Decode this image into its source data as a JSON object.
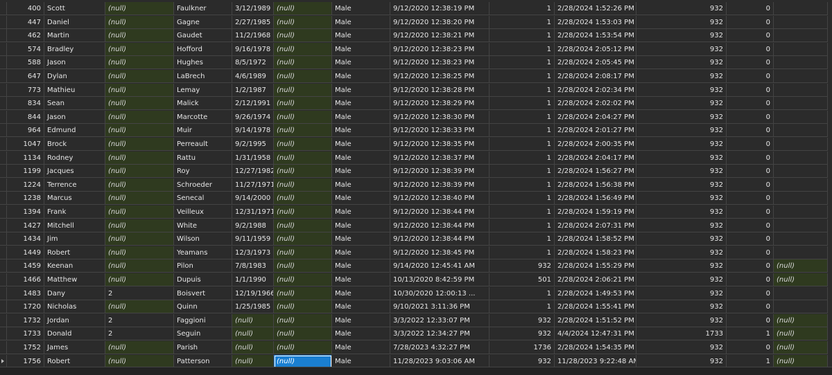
{
  "rows": [
    [
      "400",
      "Scott",
      "(null)",
      "Faulkner",
      "3/12/1989",
      "(null)",
      "Male",
      "9/12/2020 12:38:19 PM",
      "1",
      "2/28/2024 1:52:26 PM",
      "932",
      "0",
      ""
    ],
    [
      "447",
      "Daniel",
      "(null)",
      "Gagne",
      "2/27/1985",
      "(null)",
      "Male",
      "9/12/2020 12:38:20 PM",
      "1",
      "2/28/2024 1:53:03 PM",
      "932",
      "0",
      ""
    ],
    [
      "462",
      "Martin",
      "(null)",
      "Gaudet",
      "11/2/1968",
      "(null)",
      "Male",
      "9/12/2020 12:38:21 PM",
      "1",
      "2/28/2024 1:53:54 PM",
      "932",
      "0",
      ""
    ],
    [
      "574",
      "Bradley",
      "(null)",
      "Hofford",
      "9/16/1978",
      "(null)",
      "Male",
      "9/12/2020 12:38:23 PM",
      "1",
      "2/28/2024 2:05:12 PM",
      "932",
      "0",
      ""
    ],
    [
      "588",
      "Jason",
      "(null)",
      "Hughes",
      "8/5/1972",
      "(null)",
      "Male",
      "9/12/2020 12:38:23 PM",
      "1",
      "2/28/2024 2:05:45 PM",
      "932",
      "0",
      ""
    ],
    [
      "647",
      "Dylan",
      "(null)",
      "LaBrech",
      "4/6/1989",
      "(null)",
      "Male",
      "9/12/2020 12:38:25 PM",
      "1",
      "2/28/2024 2:08:17 PM",
      "932",
      "0",
      ""
    ],
    [
      "773",
      "Mathieu",
      "(null)",
      "Lemay",
      "1/2/1987",
      "(null)",
      "Male",
      "9/12/2020 12:38:28 PM",
      "1",
      "2/28/2024 2:02:34 PM",
      "932",
      "0",
      ""
    ],
    [
      "834",
      "Sean",
      "(null)",
      "Malick",
      "2/12/1991",
      "(null)",
      "Male",
      "9/12/2020 12:38:29 PM",
      "1",
      "2/28/2024 2:02:02 PM",
      "932",
      "0",
      ""
    ],
    [
      "844",
      "Jason",
      "(null)",
      "Marcotte",
      "9/26/1974",
      "(null)",
      "Male",
      "9/12/2020 12:38:30 PM",
      "1",
      "2/28/2024 2:04:27 PM",
      "932",
      "0",
      ""
    ],
    [
      "964",
      "Edmund",
      "(null)",
      "Muir",
      "9/14/1978",
      "(null)",
      "Male",
      "9/12/2020 12:38:33 PM",
      "1",
      "2/28/2024 2:01:27 PM",
      "932",
      "0",
      ""
    ],
    [
      "1047",
      "Brock",
      "(null)",
      "Perreault",
      "9/2/1995",
      "(null)",
      "Male",
      "9/12/2020 12:38:35 PM",
      "1",
      "2/28/2024 2:00:35 PM",
      "932",
      "0",
      ""
    ],
    [
      "1134",
      "Rodney",
      "(null)",
      "Rattu",
      "1/31/1958",
      "(null)",
      "Male",
      "9/12/2020 12:38:37 PM",
      "1",
      "2/28/2024 2:04:17 PM",
      "932",
      "0",
      ""
    ],
    [
      "1199",
      "Jacques",
      "(null)",
      "Roy",
      "12/27/1982",
      "(null)",
      "Male",
      "9/12/2020 12:38:39 PM",
      "1",
      "2/28/2024 1:56:27 PM",
      "932",
      "0",
      ""
    ],
    [
      "1224",
      "Terrence",
      "(null)",
      "Schroeder",
      "11/27/1971",
      "(null)",
      "Male",
      "9/12/2020 12:38:39 PM",
      "1",
      "2/28/2024 1:56:38 PM",
      "932",
      "0",
      ""
    ],
    [
      "1238",
      "Marcus",
      "(null)",
      "Senecal",
      "9/14/2000",
      "(null)",
      "Male",
      "9/12/2020 12:38:40 PM",
      "1",
      "2/28/2024 1:56:49 PM",
      "932",
      "0",
      ""
    ],
    [
      "1394",
      "Frank",
      "(null)",
      "Veilleux",
      "12/31/1971",
      "(null)",
      "Male",
      "9/12/2020 12:38:44 PM",
      "1",
      "2/28/2024 1:59:19 PM",
      "932",
      "0",
      ""
    ],
    [
      "1427",
      "Mitchell",
      "(null)",
      "White",
      "9/2/1988",
      "(null)",
      "Male",
      "9/12/2020 12:38:44 PM",
      "1",
      "2/28/2024 2:07:31 PM",
      "932",
      "0",
      ""
    ],
    [
      "1434",
      "Jim",
      "(null)",
      "Wilson",
      "9/11/1959",
      "(null)",
      "Male",
      "9/12/2020 12:38:44 PM",
      "1",
      "2/28/2024 1:58:52 PM",
      "932",
      "0",
      ""
    ],
    [
      "1449",
      "Robert",
      "(null)",
      "Yeamans",
      "12/3/1973",
      "(null)",
      "Male",
      "9/12/2020 12:38:45 PM",
      "1",
      "2/28/2024 1:58:23 PM",
      "932",
      "0",
      ""
    ],
    [
      "1459",
      "Keenan",
      "(null)",
      "Pilon",
      "7/8/1983",
      "(null)",
      "Male",
      "9/14/2020 12:45:41 AM",
      "932",
      "2/28/2024 1:55:29 PM",
      "932",
      "0",
      "(null)"
    ],
    [
      "1466",
      "Matthew",
      "(null)",
      "Dupuis",
      "1/1/1990",
      "(null)",
      "Male",
      "10/13/2020 8:42:59 PM",
      "501",
      "2/28/2024 2:06:21 PM",
      "932",
      "0",
      "(null)"
    ],
    [
      "1483",
      "Dany",
      "2",
      "Boisvert",
      "12/19/1966",
      "(null)",
      "Male",
      "10/30/2020 12:00:13 ...",
      "1",
      "2/28/2024 1:49:53 PM",
      "932",
      "0",
      ""
    ],
    [
      "1720",
      "Nicholas",
      "(null)",
      "Quinn",
      "1/25/1985",
      "(null)",
      "Male",
      "9/10/2021 3:11:36 PM",
      "1",
      "2/28/2024 1:55:41 PM",
      "932",
      "0",
      ""
    ],
    [
      "1732",
      "Jordan",
      "2",
      "Faggioni",
      "(null)",
      "(null)",
      "Male",
      "3/3/2022 12:33:07 PM",
      "932",
      "2/28/2024 1:51:52 PM",
      "932",
      "0",
      "(null)"
    ],
    [
      "1733",
      "Donald",
      "2",
      "Seguin",
      "(null)",
      "(null)",
      "Male",
      "3/3/2022 12:34:27 PM",
      "932",
      "4/4/2024 12:47:31 PM",
      "1733",
      "1",
      "(null)"
    ],
    [
      "1752",
      "James",
      "(null)",
      "Parish",
      "(null)",
      "(null)",
      "Male",
      "7/28/2023 4:32:27 PM",
      "1736",
      "2/28/2024 1:54:35 PM",
      "932",
      "0",
      "(null)"
    ],
    [
      "1756",
      "Robert",
      "(null)",
      "Patterson",
      "(null)",
      "(null)",
      "Male",
      "11/28/2023 9:03:06 AM",
      "932",
      "11/28/2023 9:22:48 AM",
      "932",
      "1",
      "(null)"
    ]
  ],
  "selected": {
    "row": 26,
    "col": 5
  },
  "colors": {
    "null_bg": "#2f3a1f",
    "selection": "#1a7fd1"
  }
}
